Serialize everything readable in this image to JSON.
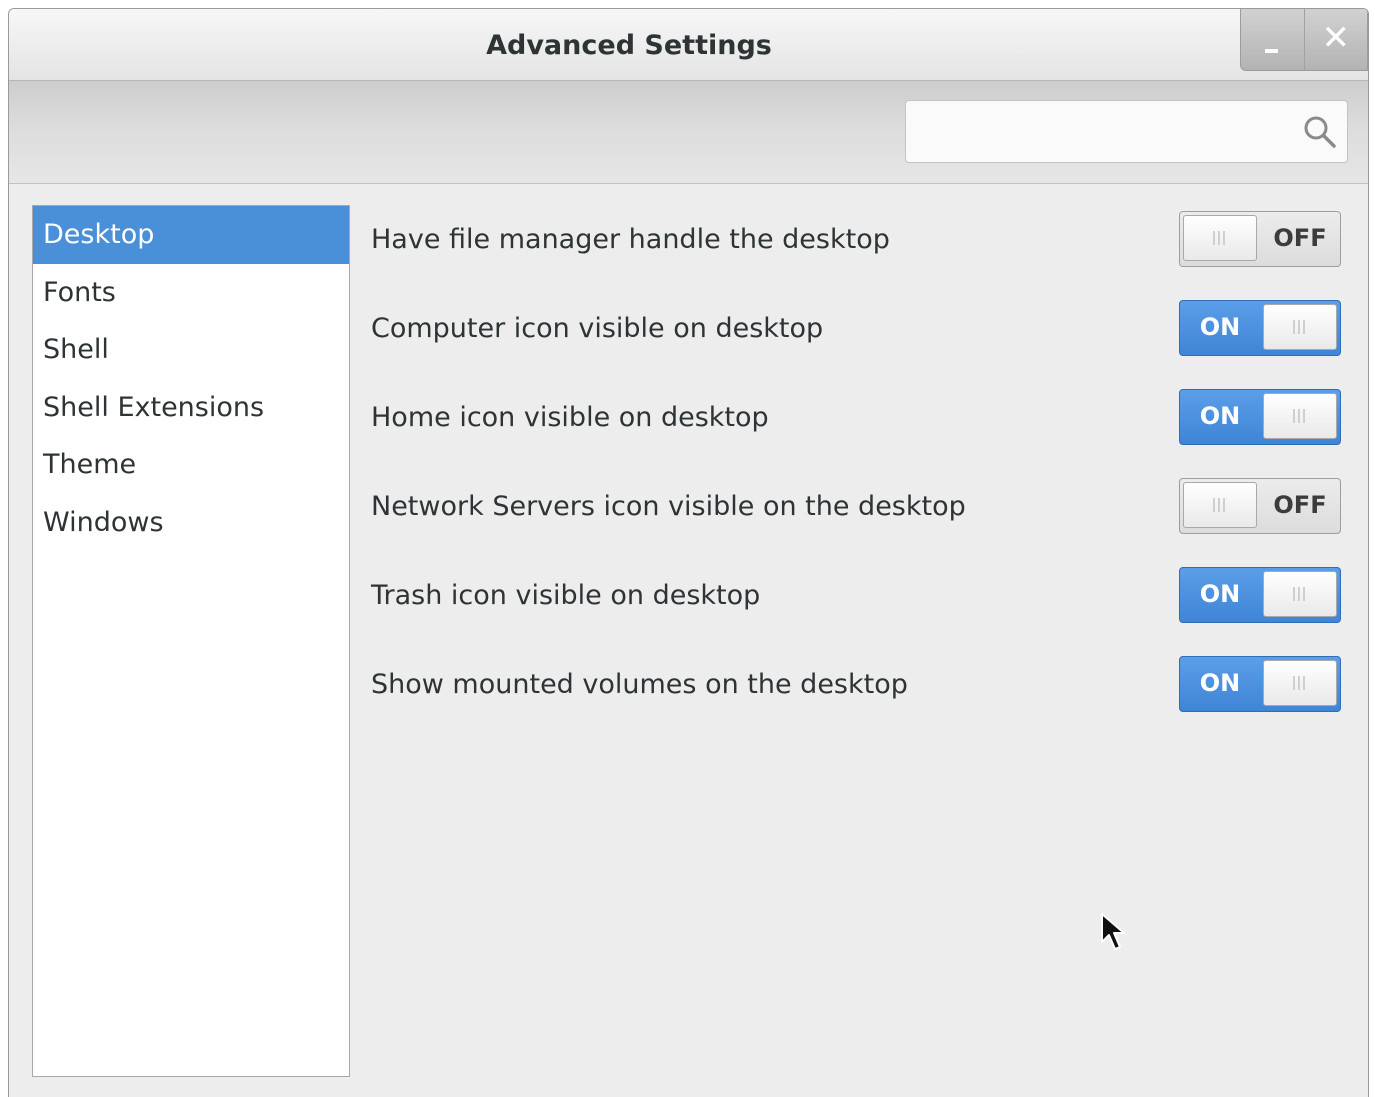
{
  "window": {
    "title": "Advanced Settings",
    "minimize_label": "minimize",
    "close_label": "close"
  },
  "search": {
    "value": "",
    "placeholder": "",
    "icon": "search-icon"
  },
  "sidebar": {
    "items": [
      {
        "label": "Desktop",
        "selected": true
      },
      {
        "label": "Fonts",
        "selected": false
      },
      {
        "label": "Shell",
        "selected": false
      },
      {
        "label": "Shell Extensions",
        "selected": false
      },
      {
        "label": "Theme",
        "selected": false
      },
      {
        "label": "Windows",
        "selected": false
      }
    ]
  },
  "settings": [
    {
      "label": "Have file manager handle the desktop",
      "state": "OFF"
    },
    {
      "label": "Computer icon visible on desktop",
      "state": "ON"
    },
    {
      "label": "Home icon visible on desktop",
      "state": "ON"
    },
    {
      "label": "Network Servers icon visible on the desktop",
      "state": "OFF"
    },
    {
      "label": "Trash icon visible on desktop",
      "state": "ON"
    },
    {
      "label": "Show mounted volumes on the desktop",
      "state": "ON"
    }
  ],
  "colors": {
    "accent": "#4a90d9",
    "window_bg": "#ededed",
    "text": "#2e3436"
  }
}
